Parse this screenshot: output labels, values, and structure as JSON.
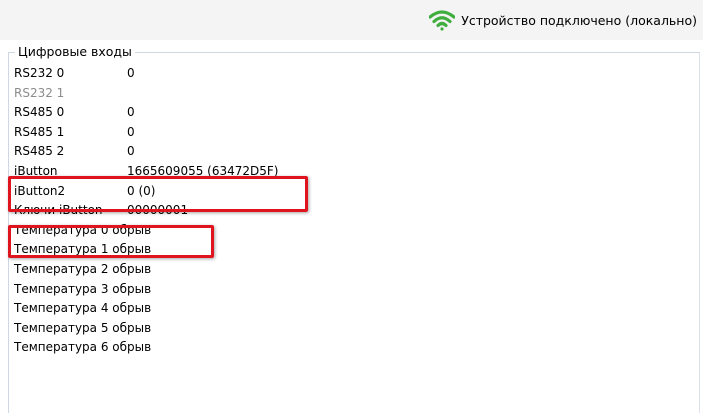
{
  "status": {
    "text": "Устройство подключено (локально)",
    "icon": "wifi-signal-icon",
    "icon_color": "#3fae3f"
  },
  "group": {
    "title": "Цифровые входы"
  },
  "rows": [
    {
      "label": "RS232 0",
      "value": "0",
      "disabled": false
    },
    {
      "label": "RS232 1",
      "value": "",
      "disabled": true
    },
    {
      "label": "RS485 0",
      "value": "0",
      "disabled": false
    },
    {
      "label": "RS485 1",
      "value": "0",
      "disabled": false
    },
    {
      "label": "RS485 2",
      "value": "0",
      "disabled": false
    },
    {
      "label": "iButton",
      "value": "1665609055 (63472D5F)",
      "disabled": false,
      "highlighted": true
    },
    {
      "label": "iButton2",
      "value": "0 (0)",
      "disabled": false
    },
    {
      "label": "Ключи iButton",
      "value": "00000001",
      "disabled": false,
      "highlighted": true
    },
    {
      "label": "Температура 0 обрыв",
      "value": "",
      "disabled": false
    },
    {
      "label": "Температура 1 обрыв",
      "value": "",
      "disabled": false
    },
    {
      "label": "Температура 2 обрыв",
      "value": "",
      "disabled": false
    },
    {
      "label": "Температура 3 обрыв",
      "value": "",
      "disabled": false
    },
    {
      "label": "Температура 4 обрыв",
      "value": "",
      "disabled": false
    },
    {
      "label": "Температура 5 обрыв",
      "value": "",
      "disabled": false
    },
    {
      "label": "Температура 6 обрыв",
      "value": "",
      "disabled": false
    }
  ],
  "colors": {
    "highlight": "#e0141e",
    "disabled_text": "#8c8c8c"
  }
}
